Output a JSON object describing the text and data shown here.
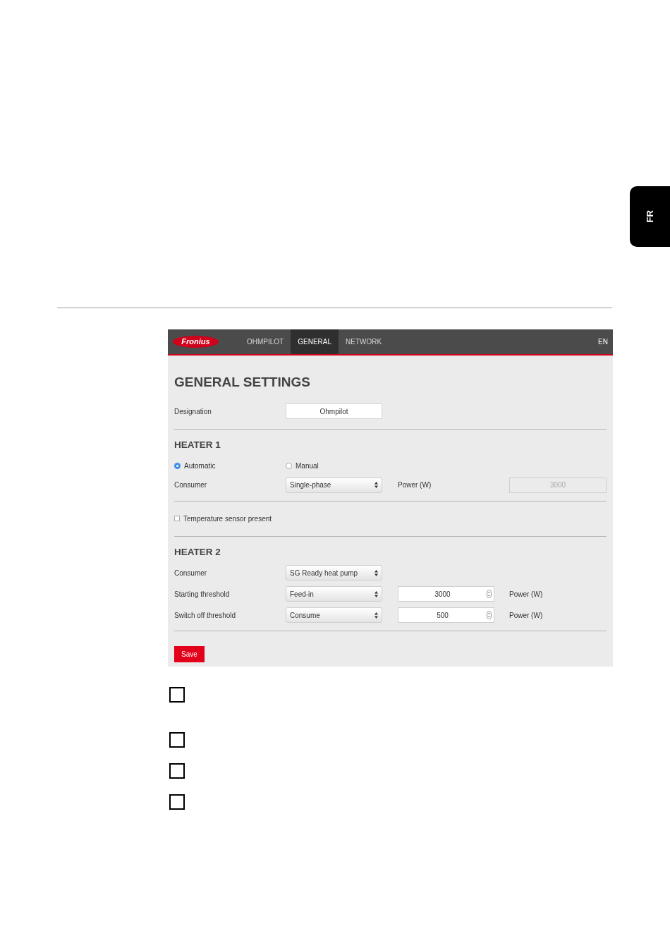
{
  "side_tab": {
    "label": "FR"
  },
  "app": {
    "logo": "Fronius",
    "nav": [
      {
        "label": "OHMPILOT",
        "selected": false
      },
      {
        "label": "GENERAL",
        "selected": true
      },
      {
        "label": "NETWORK",
        "selected": false
      }
    ],
    "language": "EN",
    "title": "GENERAL SETTINGS",
    "designation": {
      "label": "Designation",
      "value": "Ohmpilot"
    },
    "heater_1": {
      "title": "HEATER 1",
      "modes": [
        {
          "label": "Automatic",
          "selected": true
        },
        {
          "label": "Manual",
          "selected": false
        }
      ],
      "consumer": {
        "label": "Consumer",
        "value": "Single-phase"
      },
      "power": {
        "label": "Power (W)",
        "value": "3000",
        "disabled": true
      },
      "temperature_sensor": {
        "label": "Temperature sensor present",
        "checked": false
      }
    },
    "heater_2": {
      "title": "HEATER 2",
      "consumer": {
        "label": "Consumer",
        "value": "SG Ready heat pump"
      },
      "thresholds": [
        {
          "label": "Starting threshold",
          "mode": "Feed-in",
          "value": "3000",
          "unit": "Power (W)"
        },
        {
          "label": "Switch off threshold",
          "mode": "Consume",
          "value": "500",
          "unit": "Power (W)"
        }
      ]
    },
    "save": "Save"
  },
  "steps": [
    {
      "checked": false
    },
    {
      "checked": false
    },
    {
      "checked": false
    },
    {
      "checked": false
    }
  ]
}
